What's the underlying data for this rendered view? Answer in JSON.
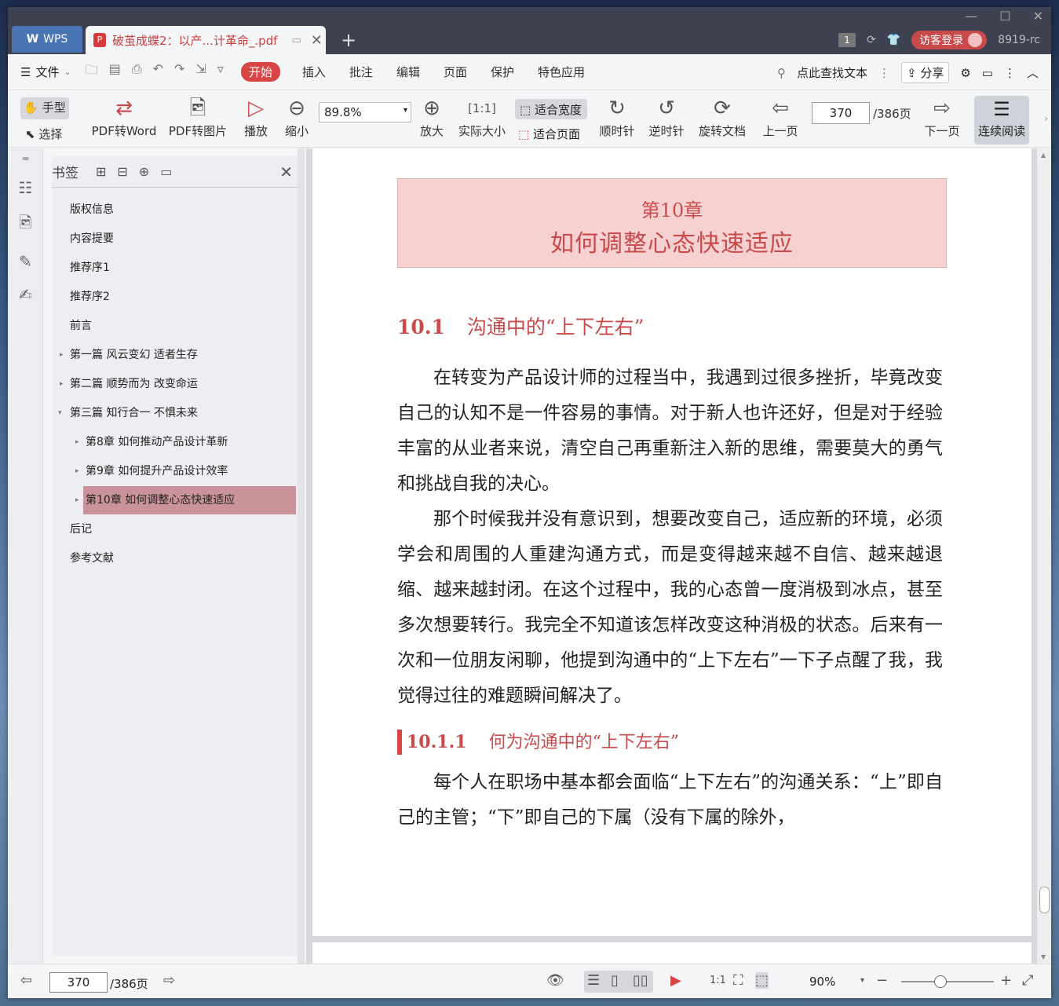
{
  "titlebar": {
    "app_name": "WPS",
    "doc_tab_title": "破茧成蝶2：以产...计革命_.pdf",
    "badge_count": "1",
    "visitor_login": "访客登录",
    "user_id": "8919-rc"
  },
  "menubar": {
    "file": "文件",
    "items": [
      "开始",
      "插入",
      "批注",
      "编辑",
      "页面",
      "保护",
      "特色应用"
    ],
    "active_item": "开始",
    "search": "点此查找文本",
    "share": "分享"
  },
  "toolbar": {
    "hand": "手型",
    "select": "选择",
    "pdf_to_word": "PDF转Word",
    "pdf_to_image": "PDF转图片",
    "play": "播放",
    "zoom_out": "缩小",
    "zoom_value": "89.8%",
    "zoom_in": "放大",
    "actual_size": "实际大小",
    "fit_width": "适合宽度",
    "fit_page": "适合页面",
    "clockwise": "顺时针",
    "counterclockwise": "逆时针",
    "rotate_doc": "旋转文档",
    "prev_page": "上一页",
    "page_number": "370",
    "page_total": "/386页",
    "next_page": "下一页",
    "continuous_read": "连续阅读"
  },
  "bookmarks": {
    "title": "书签",
    "items": [
      {
        "label": "版权信息"
      },
      {
        "label": "内容提要"
      },
      {
        "label": "推荐序1"
      },
      {
        "label": "推荐序2"
      },
      {
        "label": "前言"
      },
      {
        "label": "第一篇 风云变幻 适者生存"
      },
      {
        "label": "第二篇 顺势而为 改变命运"
      },
      {
        "label": "第三篇 知行合一 不惧未来"
      },
      {
        "label": "第8章 如何推动产品设计革新"
      },
      {
        "label": "第9章 如何提升产品设计效率"
      },
      {
        "label": "第10章 如何调整心态快速适应"
      },
      {
        "label": "后记"
      },
      {
        "label": "参考文献"
      }
    ]
  },
  "document": {
    "chapter_num": "第10章",
    "chapter_title": "如何调整心态快速适应",
    "section_num": "10.1",
    "section_title": "沟通中的“上下左右”",
    "para1": "在转变为产品设计师的过程当中，我遇到过很多挫折，毕竟改变自己的认知不是一件容易的事情。对于新人也许还好，但是对于经验丰富的从业者来说，清空自己再重新注入新的思维，需要莫大的勇气和挑战自我的决心。",
    "para2": "那个时候我并没有意识到，想要改变自己，适应新的环境，必须学会和周围的人重建沟通方式，而是变得越来越不自信、越来越退缩、越来越封闭。在这个过程中，我的心态曾一度消极到冰点，甚至多次想要转行。我完全不知道该怎样改变这种消极的状态。后来有一次和一位朋友闲聊，他提到沟通中的“上下左右”一下子点醒了我，我觉得过往的难题瞬间解决了。",
    "subsection_num": "10.1.1",
    "subsection_title": "何为沟通中的“上下左右”",
    "para3": "每个人在职场中基本都会面临“上下左右”的沟通关系：“上”即自己的主管；“下”即自己的下属（没有下属的除外，"
  },
  "statusbar": {
    "page_number": "370",
    "page_total": "/386页",
    "zoom": "90%"
  },
  "colors": {
    "accent_red": "#d84545",
    "chapter_bg": "#f6d1d1",
    "bookmark_selected": "#c9939a"
  }
}
